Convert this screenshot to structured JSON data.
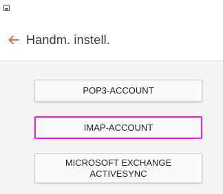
{
  "header": {
    "title": "Handm. instell.",
    "back_icon": "arrow-left-icon",
    "accent_color": "#e05a3c"
  },
  "buttons": {
    "pop3": "POP3-ACCOUNT",
    "imap": "IMAP-ACCOUNT",
    "exchange_line1": "MICROSOFT EXCHANGE",
    "exchange_line2": "ACTIVESYNC"
  },
  "highlight_color": "#e21ee6"
}
